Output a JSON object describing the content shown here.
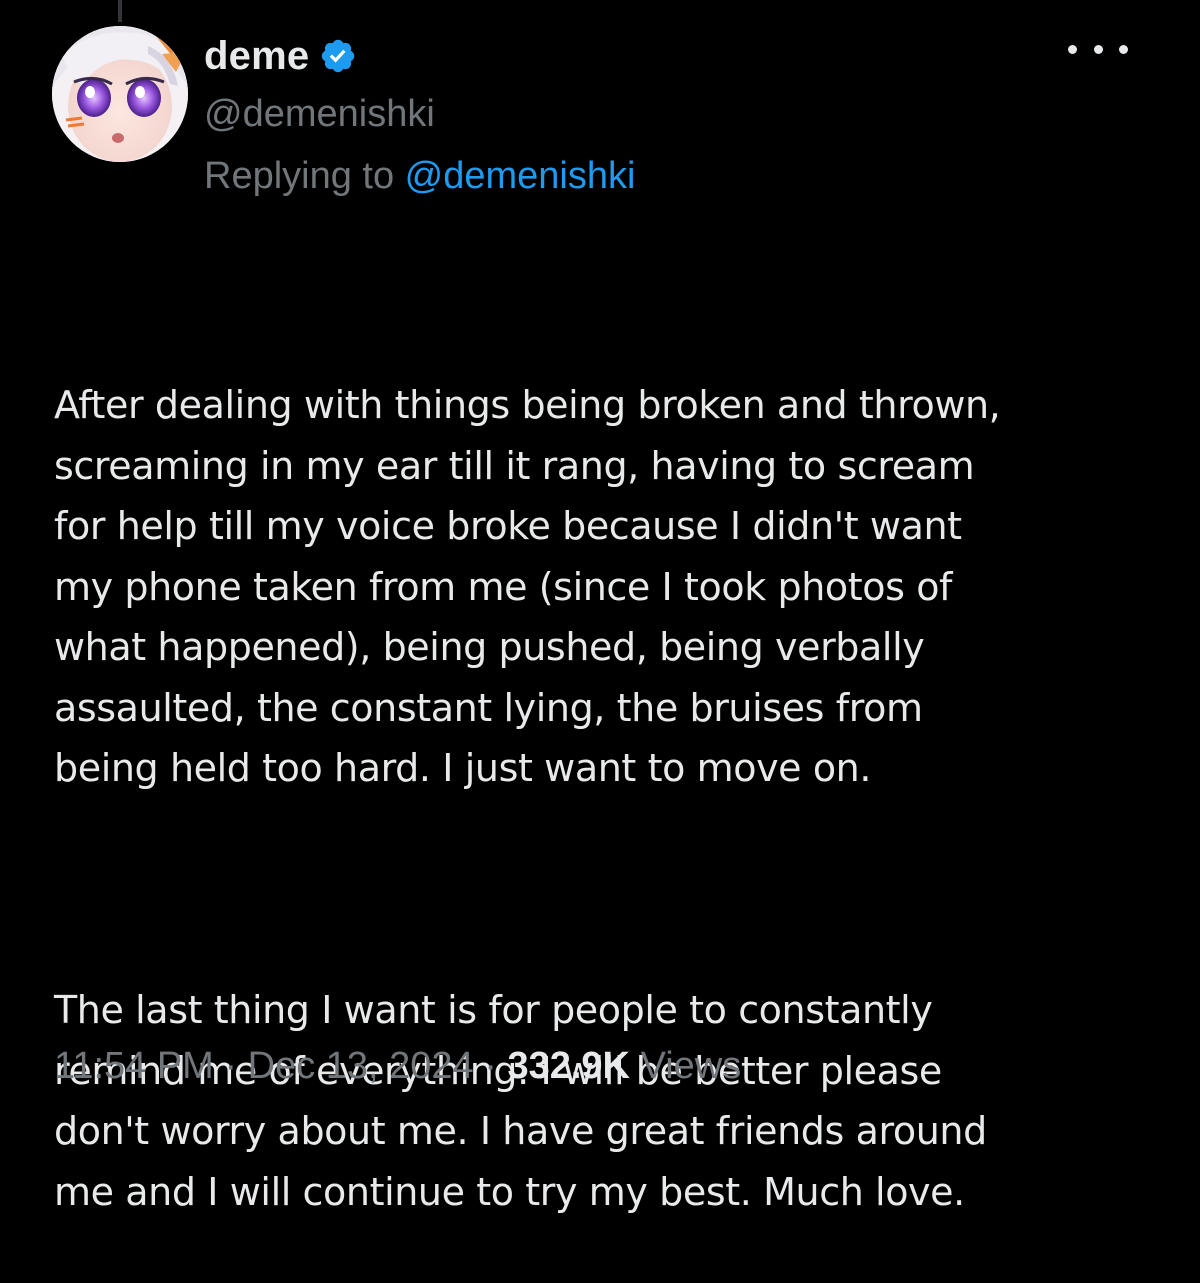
{
  "author": {
    "display_name": "deme",
    "handle": "@demenishki",
    "verified": true,
    "verified_badge_color": "#1d9bf0",
    "avatar_icon": "anime-avatar"
  },
  "reply": {
    "prefix": "Replying to ",
    "handle": "@demenishki"
  },
  "menu": {
    "icon": "more-horizontal-icon"
  },
  "tweet": {
    "paragraph_1": "After dealing with things being broken and thrown,\nscreaming in my ear till it rang, having to scream\nfor help till my voice broke because I didn't want\nmy phone taken from me (since I took photos of\nwhat happened), being pushed, being verbally\nassaulted, the constant lying, the bruises from\nbeing held too hard. I just want to move on.",
    "paragraph_2": "The last thing I want is for people to constantly\nremind me of everything. I will be better please\ndon't worry about me. I have great friends around\nme and I will continue to try my best. Much love."
  },
  "meta": {
    "time": "11:54 PM",
    "separator": " · ",
    "date": "Dec 13, 2024",
    "views_count": "332.9K",
    "views_label": " Views"
  },
  "colors": {
    "background": "#000000",
    "text_primary": "#e7e9ea",
    "text_secondary": "#71767b",
    "accent": "#1d9bf0"
  }
}
